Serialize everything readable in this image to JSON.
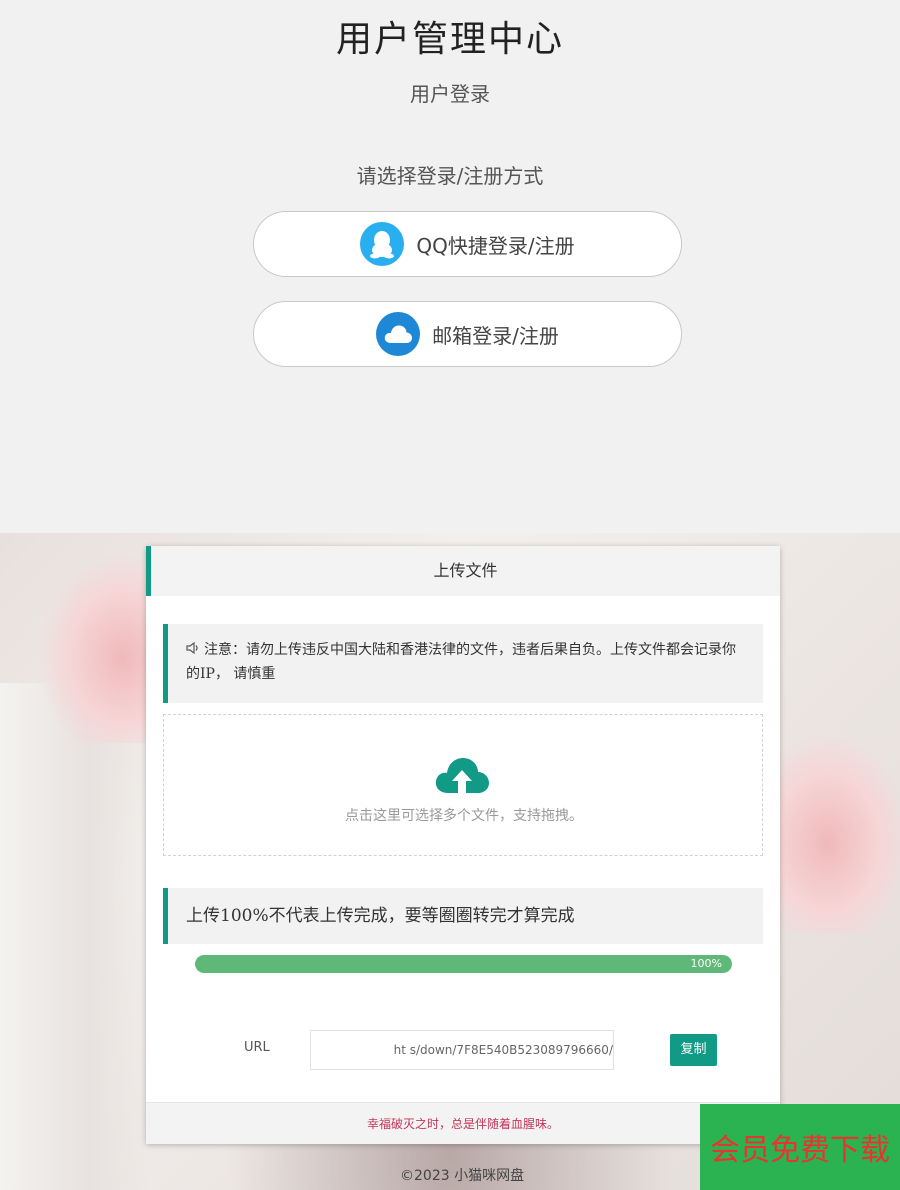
{
  "login": {
    "title": "用户管理中心",
    "subtitle": "用户登录",
    "choose_text": "请选择登录/注册方式",
    "qq_button": "QQ快捷登录/注册",
    "email_button": "邮箱登录/注册",
    "qq_icon": "qq-penguin-icon",
    "email_icon": "cloud-icon"
  },
  "upload": {
    "header": "上传文件",
    "notice": "注意：请勿上传违反中国大陆和香港法律的文件，违者后果自负。上传文件都会记录你的IP， 请慎重",
    "drop_hint": "点击这里可选择多个文件，支持拖拽。",
    "warning": "上传100%不代表上传完成，要等圈圈转完才算完成",
    "progress_value": 100,
    "progress_label": "100%",
    "url_label": "URL",
    "url_value": "ht                          s/down/7F8E540B523089796660/",
    "copy_button": "复制",
    "footer_text": "幸福破灭之时，总是伴随着血腥味。"
  },
  "page_footer": {
    "copyright": "©2023 小猫咪网盘"
  },
  "vip_banner": {
    "label": "会员免费下载"
  },
  "colors": {
    "accent": "#119a85",
    "progress": "#5fb878",
    "footer_text": "#c2365a",
    "vip_bg": "#2bb352",
    "vip_text": "#e8342e"
  }
}
